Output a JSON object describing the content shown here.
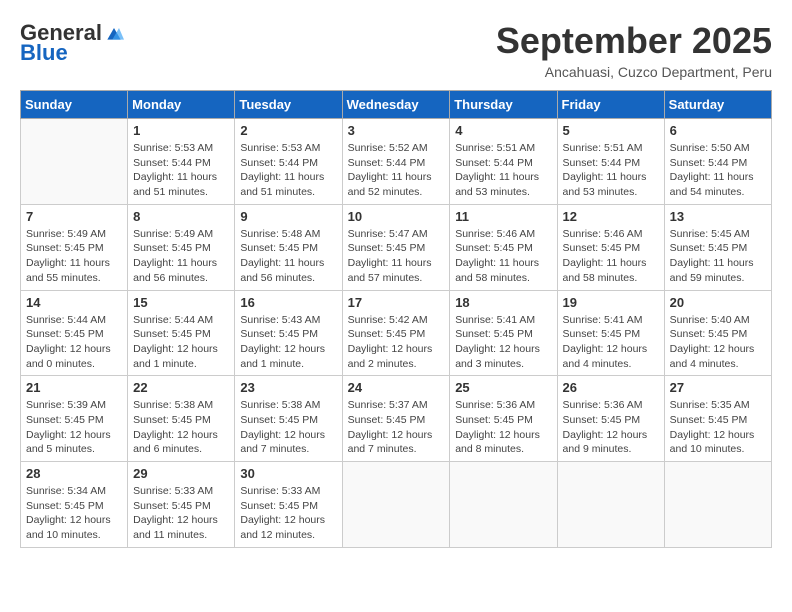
{
  "logo": {
    "general": "General",
    "blue": "Blue"
  },
  "title": "September 2025",
  "location": "Ancahuasi, Cuzco Department, Peru",
  "weekdays": [
    "Sunday",
    "Monday",
    "Tuesday",
    "Wednesday",
    "Thursday",
    "Friday",
    "Saturday"
  ],
  "weeks": [
    [
      {
        "day": "",
        "info": ""
      },
      {
        "day": "1",
        "info": "Sunrise: 5:53 AM\nSunset: 5:44 PM\nDaylight: 11 hours\nand 51 minutes."
      },
      {
        "day": "2",
        "info": "Sunrise: 5:53 AM\nSunset: 5:44 PM\nDaylight: 11 hours\nand 51 minutes."
      },
      {
        "day": "3",
        "info": "Sunrise: 5:52 AM\nSunset: 5:44 PM\nDaylight: 11 hours\nand 52 minutes."
      },
      {
        "day": "4",
        "info": "Sunrise: 5:51 AM\nSunset: 5:44 PM\nDaylight: 11 hours\nand 53 minutes."
      },
      {
        "day": "5",
        "info": "Sunrise: 5:51 AM\nSunset: 5:44 PM\nDaylight: 11 hours\nand 53 minutes."
      },
      {
        "day": "6",
        "info": "Sunrise: 5:50 AM\nSunset: 5:44 PM\nDaylight: 11 hours\nand 54 minutes."
      }
    ],
    [
      {
        "day": "7",
        "info": "Sunrise: 5:49 AM\nSunset: 5:45 PM\nDaylight: 11 hours\nand 55 minutes."
      },
      {
        "day": "8",
        "info": "Sunrise: 5:49 AM\nSunset: 5:45 PM\nDaylight: 11 hours\nand 56 minutes."
      },
      {
        "day": "9",
        "info": "Sunrise: 5:48 AM\nSunset: 5:45 PM\nDaylight: 11 hours\nand 56 minutes."
      },
      {
        "day": "10",
        "info": "Sunrise: 5:47 AM\nSunset: 5:45 PM\nDaylight: 11 hours\nand 57 minutes."
      },
      {
        "day": "11",
        "info": "Sunrise: 5:46 AM\nSunset: 5:45 PM\nDaylight: 11 hours\nand 58 minutes."
      },
      {
        "day": "12",
        "info": "Sunrise: 5:46 AM\nSunset: 5:45 PM\nDaylight: 11 hours\nand 58 minutes."
      },
      {
        "day": "13",
        "info": "Sunrise: 5:45 AM\nSunset: 5:45 PM\nDaylight: 11 hours\nand 59 minutes."
      }
    ],
    [
      {
        "day": "14",
        "info": "Sunrise: 5:44 AM\nSunset: 5:45 PM\nDaylight: 12 hours\nand 0 minutes."
      },
      {
        "day": "15",
        "info": "Sunrise: 5:44 AM\nSunset: 5:45 PM\nDaylight: 12 hours\nand 1 minute."
      },
      {
        "day": "16",
        "info": "Sunrise: 5:43 AM\nSunset: 5:45 PM\nDaylight: 12 hours\nand 1 minute."
      },
      {
        "day": "17",
        "info": "Sunrise: 5:42 AM\nSunset: 5:45 PM\nDaylight: 12 hours\nand 2 minutes."
      },
      {
        "day": "18",
        "info": "Sunrise: 5:41 AM\nSunset: 5:45 PM\nDaylight: 12 hours\nand 3 minutes."
      },
      {
        "day": "19",
        "info": "Sunrise: 5:41 AM\nSunset: 5:45 PM\nDaylight: 12 hours\nand 4 minutes."
      },
      {
        "day": "20",
        "info": "Sunrise: 5:40 AM\nSunset: 5:45 PM\nDaylight: 12 hours\nand 4 minutes."
      }
    ],
    [
      {
        "day": "21",
        "info": "Sunrise: 5:39 AM\nSunset: 5:45 PM\nDaylight: 12 hours\nand 5 minutes."
      },
      {
        "day": "22",
        "info": "Sunrise: 5:38 AM\nSunset: 5:45 PM\nDaylight: 12 hours\nand 6 minutes."
      },
      {
        "day": "23",
        "info": "Sunrise: 5:38 AM\nSunset: 5:45 PM\nDaylight: 12 hours\nand 7 minutes."
      },
      {
        "day": "24",
        "info": "Sunrise: 5:37 AM\nSunset: 5:45 PM\nDaylight: 12 hours\nand 7 minutes."
      },
      {
        "day": "25",
        "info": "Sunrise: 5:36 AM\nSunset: 5:45 PM\nDaylight: 12 hours\nand 8 minutes."
      },
      {
        "day": "26",
        "info": "Sunrise: 5:36 AM\nSunset: 5:45 PM\nDaylight: 12 hours\nand 9 minutes."
      },
      {
        "day": "27",
        "info": "Sunrise: 5:35 AM\nSunset: 5:45 PM\nDaylight: 12 hours\nand 10 minutes."
      }
    ],
    [
      {
        "day": "28",
        "info": "Sunrise: 5:34 AM\nSunset: 5:45 PM\nDaylight: 12 hours\nand 10 minutes."
      },
      {
        "day": "29",
        "info": "Sunrise: 5:33 AM\nSunset: 5:45 PM\nDaylight: 12 hours\nand 11 minutes."
      },
      {
        "day": "30",
        "info": "Sunrise: 5:33 AM\nSunset: 5:45 PM\nDaylight: 12 hours\nand 12 minutes."
      },
      {
        "day": "",
        "info": ""
      },
      {
        "day": "",
        "info": ""
      },
      {
        "day": "",
        "info": ""
      },
      {
        "day": "",
        "info": ""
      }
    ]
  ]
}
